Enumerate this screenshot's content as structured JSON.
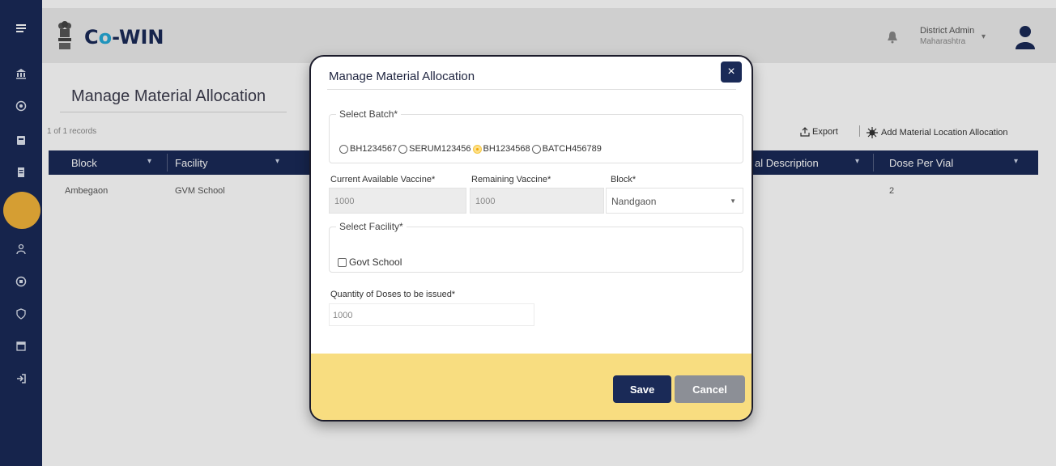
{
  "app": {
    "name_prefix": "C",
    "name_o": "o",
    "name_suffix": "-WIN"
  },
  "user": {
    "name": "District Admin",
    "region": "Maharashtra"
  },
  "nav": {
    "icons": [
      "menu-icon",
      "bank-icon",
      "globe-icon",
      "building-icon",
      "document-icon",
      "active-circle-icon",
      "person-icon",
      "monitor-icon",
      "shield-icon",
      "calendar-icon",
      "logout-icon"
    ]
  },
  "page": {
    "title": "Manage Material Allocation",
    "records": "1 of 1 records",
    "export_label": "Export",
    "add_label": "Add Material Location Allocation"
  },
  "table": {
    "columns": [
      "Block",
      "Facility",
      "al Description",
      "Dose Per Vial"
    ],
    "rows": [
      {
        "block": "Ambegaon",
        "facility": "GVM School",
        "dose_per_vial": "2"
      }
    ]
  },
  "modal": {
    "title": "Manage Material Allocation",
    "close": "×",
    "batch_legend": "Select Batch*",
    "batches": [
      {
        "label": "BH1234567",
        "checked": false
      },
      {
        "label": "SERUM123456",
        "checked": false
      },
      {
        "label": "BH1234568",
        "checked": true
      },
      {
        "label": "BATCH456789",
        "checked": false
      }
    ],
    "current_label": "Current Available Vaccine*",
    "current_value": "1000",
    "remaining_label": "Remaining Vaccine*",
    "remaining_value": "1000",
    "block_label": "Block*",
    "block_value": "Nandgaon",
    "facility_legend": "Select Facility*",
    "facility_option": "Govt School",
    "qty_label": "Quantity of Doses to be issued*",
    "qty_value": "1000",
    "save": "Save",
    "cancel": "Cancel"
  },
  "colors": {
    "navy": "#1a2a57",
    "accent_yellow": "#f8dd80",
    "cyan": "#25a9d6"
  }
}
